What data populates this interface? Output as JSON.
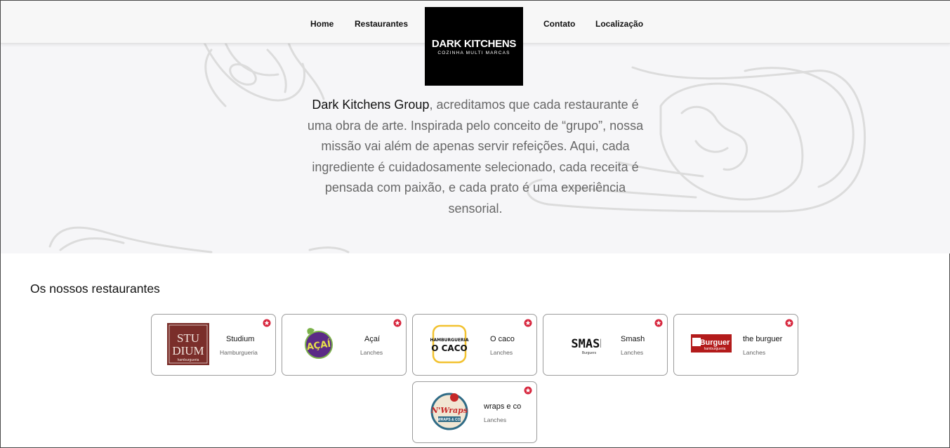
{
  "nav": {
    "home": "Home",
    "restaurantes": "Restaurantes",
    "contato": "Contato",
    "localizacao": "Localização"
  },
  "logo": {
    "title": "DARK KITCHENS",
    "subtitle": "COZINHA MULTI MARCAS"
  },
  "hero": {
    "brand": "Dark Kitchens Group",
    "mission_line1_rest": ", acreditamos que cada restaurante é",
    "mission_line2": "uma obra de arte. Inspirada pelo conceito de “grupo”, nossa",
    "mission_line3": "missão vai além de apenas servir refeições. Aqui, cada",
    "mission_line4": "ingrediente é cuidadosamente selecionado, cada receita é",
    "mission_line5": "pensada com paixão, e cada prato é uma experiência",
    "mission_line6": "sensorial."
  },
  "section": {
    "title": "Os nossos restaurantes"
  },
  "restaurants": [
    {
      "name": "Studium",
      "category": "Hamburgueria",
      "logo_text": [
        "STU",
        "DIUM",
        "hamburgueria"
      ],
      "logo_color": "#7a2e2a"
    },
    {
      "name": "Açaí",
      "category": "Lanches",
      "logo_text": [
        "AÇAÍ"
      ],
      "logo_color": "#5b2a86"
    },
    {
      "name": "O caco",
      "category": "Lanches",
      "logo_text": [
        "HAMBURGUERIA",
        "O CACO"
      ],
      "logo_color": "#f2c230"
    },
    {
      "name": "Smash",
      "category": "Lanches",
      "logo_text": [
        "SMASH",
        "Burguers"
      ],
      "logo_color": "#111111"
    },
    {
      "name": "the burguer",
      "category": "Lanches",
      "logo_text": [
        "Burguer",
        "hamburgueria"
      ],
      "logo_color": "#b31b1b"
    },
    {
      "name": "wraps e co",
      "category": "Lanches",
      "logo_text": [
        "N'Wraps",
        "WRAPS & CO."
      ],
      "logo_color": "#2f6b86"
    }
  ],
  "icons": {
    "favorite": "star-icon",
    "favorite_color": "#d7263d"
  },
  "colors": {
    "hero_bg": "#f6f6f8",
    "navbar_bg": "#f7f7f7",
    "logo_bg": "#000000"
  }
}
